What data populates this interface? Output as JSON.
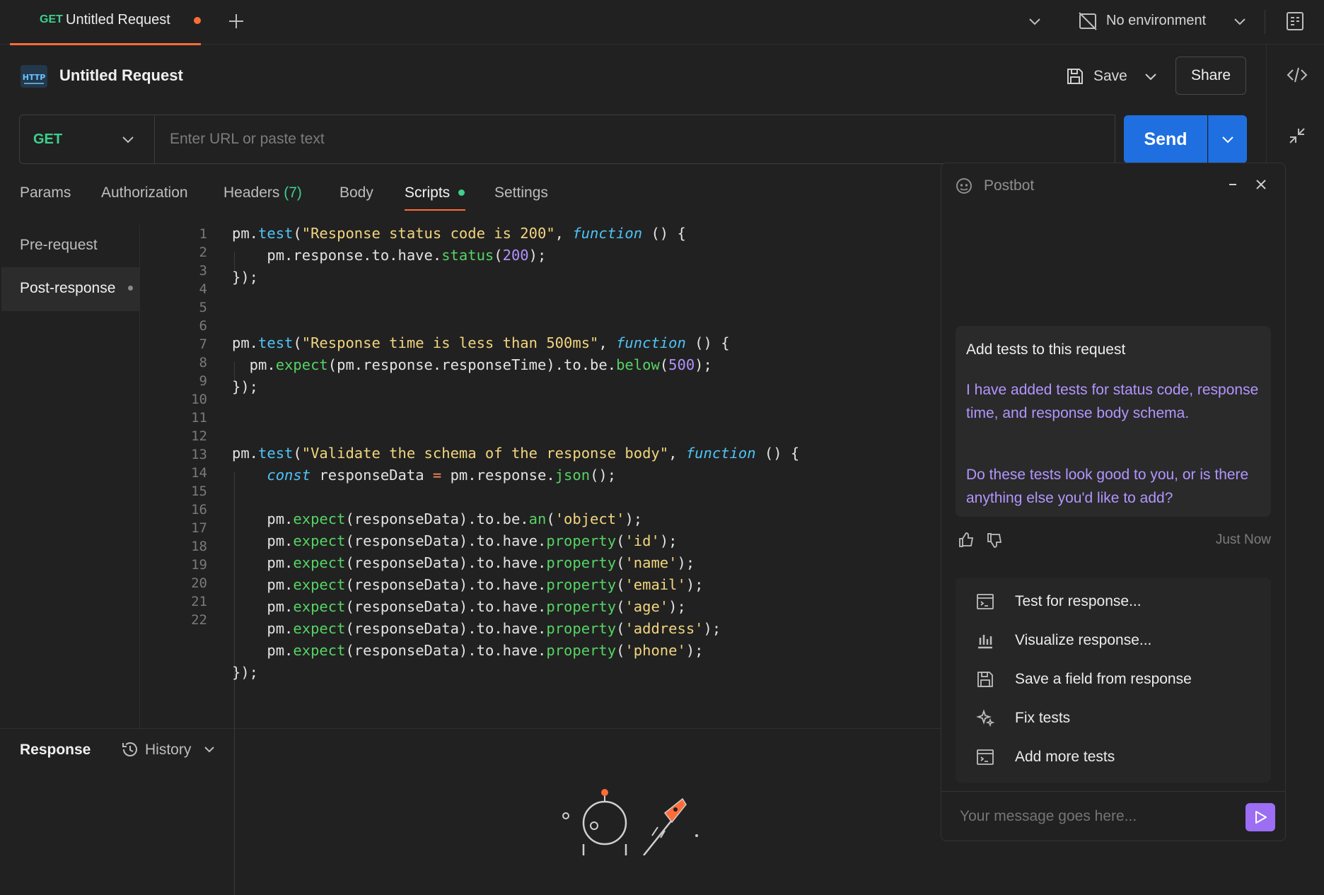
{
  "tab": {
    "method": "GET",
    "title": "Untitled Request"
  },
  "environment": {
    "label": "No environment"
  },
  "request": {
    "title": "Untitled Request",
    "save_label": "Save",
    "share_label": "Share",
    "method": "GET",
    "url_placeholder": "Enter URL or paste text",
    "send_label": "Send"
  },
  "request_tabs": {
    "params": "Params",
    "authorization": "Authorization",
    "headers": "Headers",
    "headers_count": "(7)",
    "body": "Body",
    "scripts": "Scripts",
    "settings": "Settings"
  },
  "script_tabs": {
    "pre": "Pre-request",
    "post": "Post-response"
  },
  "code": {
    "line_numbers": [
      "1",
      "2",
      "3",
      "4",
      "5",
      "6",
      "7",
      "8",
      "9",
      "10",
      "11",
      "12",
      "13",
      "14",
      "15",
      "16",
      "17",
      "18",
      "19",
      "20",
      "21",
      "22"
    ],
    "l1": [
      "pm.",
      "test",
      "(",
      "\"Response status code is 200\"",
      ", ",
      "function",
      " () {"
    ],
    "l2": [
      "    pm.response.to.have.",
      "status",
      "(",
      "200",
      ");"
    ],
    "l3": "});",
    "l6": [
      "pm.",
      "test",
      "(",
      "\"Response time is less than 500ms\"",
      ", ",
      "function",
      " () {"
    ],
    "l7": [
      "  pm.",
      "expect",
      "(pm.response.responseTime).to.be.",
      "below",
      "(",
      "500",
      ");"
    ],
    "l8": "});",
    "l11": [
      "pm.",
      "test",
      "(",
      "\"Validate the schema of the response body\"",
      ", ",
      "function",
      " () {"
    ],
    "l12": [
      "    ",
      "const",
      " responseData ",
      "=",
      " pm.response.",
      "json",
      "();"
    ],
    "l14": [
      "    pm.",
      "expect",
      "(responseData).to.be.",
      "an",
      "(",
      "'object'",
      ");"
    ],
    "l15": [
      "    pm.",
      "expect",
      "(responseData).to.have.",
      "property",
      "(",
      "'id'",
      ");"
    ],
    "l16": [
      "    pm.",
      "expect",
      "(responseData).to.have.",
      "property",
      "(",
      "'name'",
      ");"
    ],
    "l17": [
      "    pm.",
      "expect",
      "(responseData).to.have.",
      "property",
      "(",
      "'email'",
      ");"
    ],
    "l18": [
      "    pm.",
      "expect",
      "(responseData).to.have.",
      "property",
      "(",
      "'age'",
      ");"
    ],
    "l19": [
      "    pm.",
      "expect",
      "(responseData).to.have.",
      "property",
      "(",
      "'address'",
      ");"
    ],
    "l20": [
      "    pm.",
      "expect",
      "(responseData).to.have.",
      "property",
      "(",
      "'phone'",
      ");"
    ],
    "l21": "});"
  },
  "response": {
    "label": "Response",
    "history_label": "History"
  },
  "postbot": {
    "title": "Postbot",
    "prompt_title": "Add tests to this request",
    "message1": "I have added tests for status code, response time, and response body schema.",
    "message2": "Do these tests look good to you, or is there anything else you'd like to add?",
    "timestamp": "Just Now",
    "actions": [
      "Test for response...",
      "Visualize response...",
      "Save a field from response",
      "Fix tests",
      "Add more tests"
    ],
    "input_placeholder": "Your message goes here..."
  },
  "icons": {
    "tab_add": "plus-icon",
    "environment": "no-environment-icon",
    "quicklook": "environment-quick-look-icon",
    "http": "http-icon",
    "save": "save-icon",
    "code": "code-icon",
    "collapse": "collapse-icon",
    "history": "history-icon",
    "postbot": "postbot-icon"
  },
  "colors": {
    "accent": "#ff6c37",
    "send": "#1f6fe0",
    "method_get": "#3ecf8e",
    "postbot_text": "#b295ff",
    "postbot_send": "#9b6ef3"
  }
}
